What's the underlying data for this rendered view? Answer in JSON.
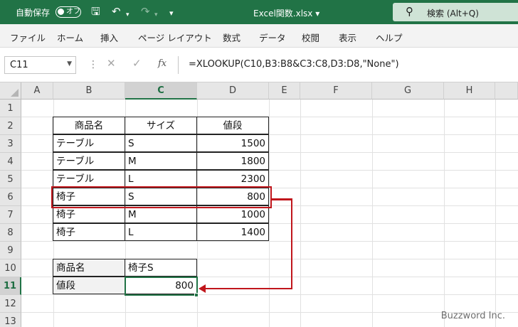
{
  "titlebar": {
    "autosave_label": "自動保存",
    "toggle_label": "オフ",
    "save_icon": "save-icon",
    "undo_icon": "undo-icon",
    "redo_icon": "redo-icon",
    "filename": "Excel関数.xlsx ▾",
    "search_placeholder": "検索 (Alt+Q)"
  },
  "ribbon": {
    "tabs": [
      "ファイル",
      "ホーム",
      "挿入",
      "ページ レイアウト",
      "数式",
      "データ",
      "校閲",
      "表示",
      "ヘルプ"
    ]
  },
  "formula_bar": {
    "name_box": "C11",
    "fx_label": "fx",
    "formula": "=XLOOKUP(C10,B3:B8&C3:C8,D3:D8,\"None\")"
  },
  "grid": {
    "columns": [
      "A",
      "B",
      "C",
      "D",
      "E",
      "F",
      "G",
      "H"
    ],
    "rows": [
      "1",
      "2",
      "3",
      "4",
      "5",
      "6",
      "7",
      "8",
      "9",
      "10",
      "11",
      "12",
      "13"
    ],
    "selected_column": "C",
    "selected_row": "11"
  },
  "table": {
    "headers": [
      "商品名",
      "サイズ",
      "値段"
    ],
    "rows": [
      [
        "テーブル",
        "S",
        "1500"
      ],
      [
        "テーブル",
        "M",
        "1800"
      ],
      [
        "テーブル",
        "L",
        "2300"
      ],
      [
        "椅子",
        "S",
        "800"
      ],
      [
        "椅子",
        "M",
        "1000"
      ],
      [
        "椅子",
        "L",
        "1400"
      ]
    ]
  },
  "lookup": {
    "label_name": "商品名",
    "value_name": "椅子S",
    "label_price": "値段",
    "value_price": "800"
  },
  "colors": {
    "accent": "#217346",
    "highlight": "#c0161c"
  },
  "watermark": "Buzzword Inc."
}
